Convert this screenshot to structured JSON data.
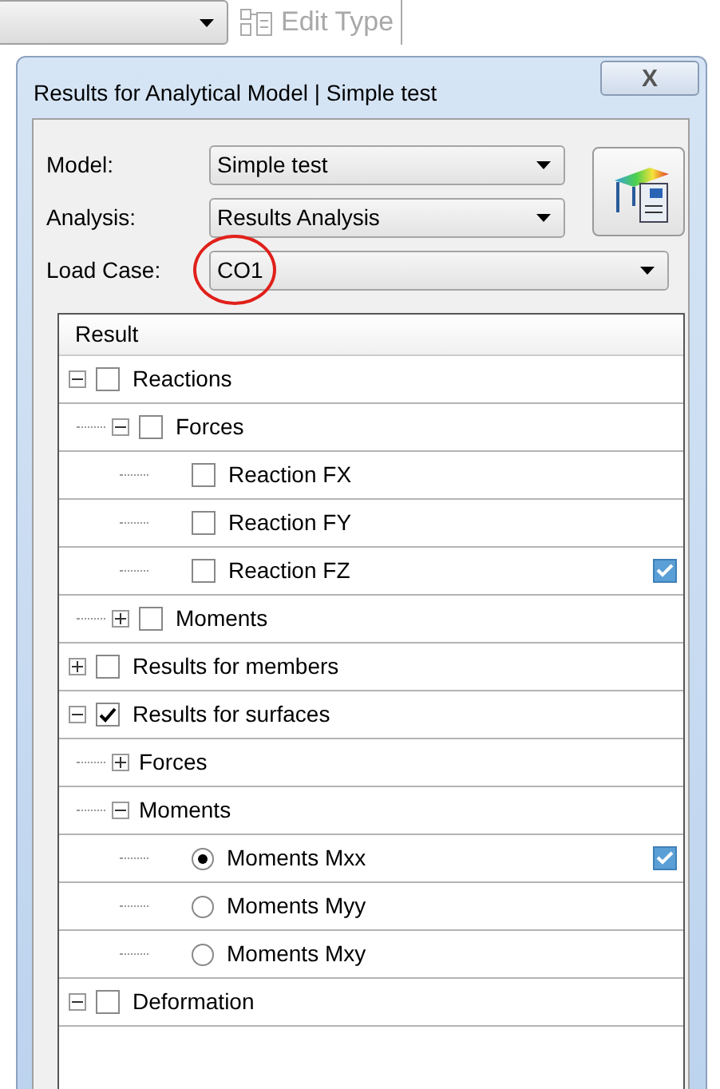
{
  "toolbar": {
    "edit_type_button": {
      "label": "Edit Type",
      "disabled": true
    }
  },
  "dialog": {
    "title": "Results for Analytical Model | Simple test",
    "close_label": "X",
    "fields": [
      {
        "label": "Model:",
        "value": "Simple test"
      },
      {
        "label": "Analysis:",
        "value": "Results Analysis"
      },
      {
        "label": "Load Case:",
        "value": "CO1",
        "circled": true
      }
    ],
    "tree": {
      "column": "Result",
      "items": [
        {
          "label": "Reactions",
          "kind": "checkbox",
          "checked": false,
          "expanded": true,
          "children": [
            {
              "label": "Forces",
              "kind": "checkbox",
              "checked": false,
              "expanded": true,
              "children": [
                {
                  "label": "Reaction FX",
                  "kind": "checkbox",
                  "checked": false,
                  "displayed": false
                },
                {
                  "label": "Reaction FY",
                  "kind": "checkbox",
                  "checked": false,
                  "displayed": false
                },
                {
                  "label": "Reaction FZ",
                  "kind": "checkbox",
                  "checked": false,
                  "displayed": true
                }
              ]
            },
            {
              "label": "Moments",
              "kind": "checkbox",
              "checked": false,
              "expanded": false
            }
          ]
        },
        {
          "label": "Results for members",
          "kind": "checkbox",
          "checked": false,
          "expanded": false
        },
        {
          "label": "Results for surfaces",
          "kind": "checkbox",
          "checked": true,
          "expanded": true,
          "children": [
            {
              "label": "Forces",
              "kind": "plain",
              "expanded": false
            },
            {
              "label": "Moments",
              "kind": "plain",
              "expanded": true,
              "children": [
                {
                  "label": "Moments Mxx",
                  "kind": "radio",
                  "selected": true,
                  "displayed": true
                },
                {
                  "label": "Moments Myy",
                  "kind": "radio",
                  "selected": false,
                  "displayed": false
                },
                {
                  "label": "Moments Mxy",
                  "kind": "radio",
                  "selected": false,
                  "displayed": false
                }
              ]
            }
          ]
        },
        {
          "label": "Deformation",
          "kind": "checkbox",
          "checked": false,
          "expanded": true
        }
      ]
    }
  }
}
